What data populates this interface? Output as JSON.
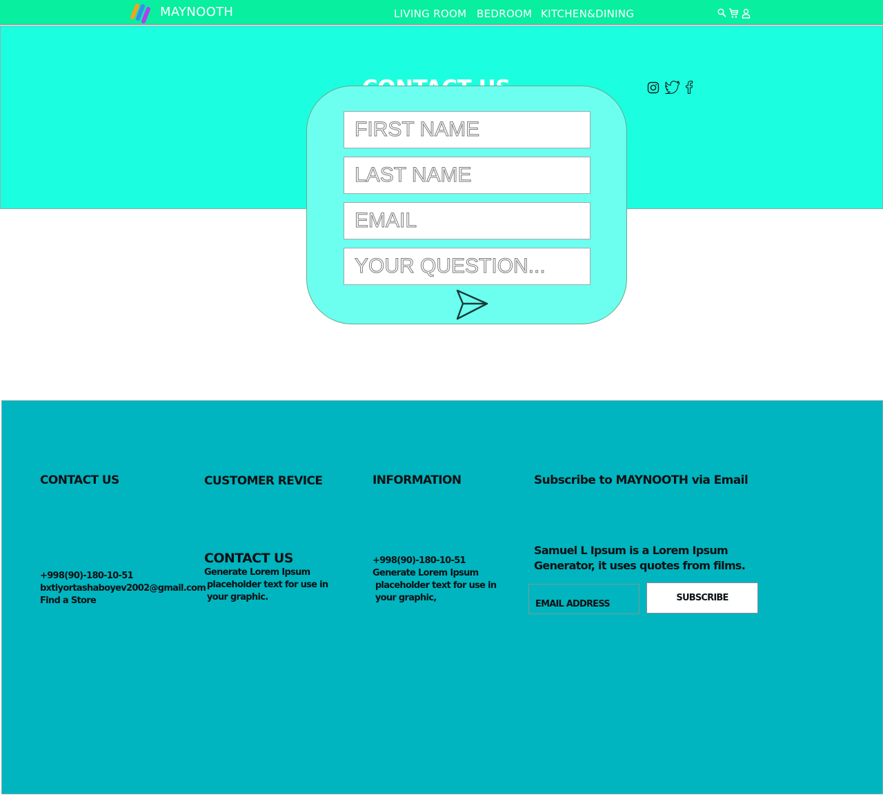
{
  "nav": {
    "brand": "MAYNOOTH",
    "links": [
      "LIVING ROOM",
      "BEDROOM",
      "KITCHEN&DINING"
    ],
    "icons": [
      "search-icon",
      "cart-icon",
      "user-icon"
    ]
  },
  "hero": {
    "title": "CONTACT US",
    "social_icons": [
      "instagram-icon",
      "twitter-icon",
      "facebook-icon"
    ]
  },
  "form": {
    "first_name_placeholder": "FIRST NAME",
    "last_name_placeholder": "LAST NAME",
    "email_placeholder": "EMAIL",
    "question_placeholder": "YOUR QUESTION...",
    "send_icon": "send-icon"
  },
  "footer": {
    "col1": {
      "heading": "CONTACT US",
      "phone": "+998(90)-180-10-51",
      "email": "bxtiyortashaboyev2002@gmail.com",
      "store": "Find a Store"
    },
    "col2": {
      "heading": "CUSTOMER REVICE",
      "subheading": "CONTACT US",
      "lines": [
        "Generate Lorem Ipsum",
        " placeholder text for use in",
        " your graphic."
      ]
    },
    "col3": {
      "heading": "INFORMATION",
      "phone": "+998(90)-180-10-51",
      "lines": [
        "Generate Lorem Ipsum",
        " placeholder text for use in",
        " your graphic,"
      ]
    },
    "col4": {
      "heading": "Subscribe to MAYNOOTH via Email",
      "lines": [
        "Samuel L Ipsum is a Lorem Ipsum",
        "Generator, it uses quotes from films."
      ],
      "email_placeholder": "EMAIL ADDRESS",
      "subscribe_label": "SUBSCRIBE"
    }
  },
  "colors": {
    "nav_bg": "#08ef9f",
    "hero_bg": "#1bffe0",
    "form_bg": "#6cfff0",
    "footer_bg": "#00b5bf"
  }
}
